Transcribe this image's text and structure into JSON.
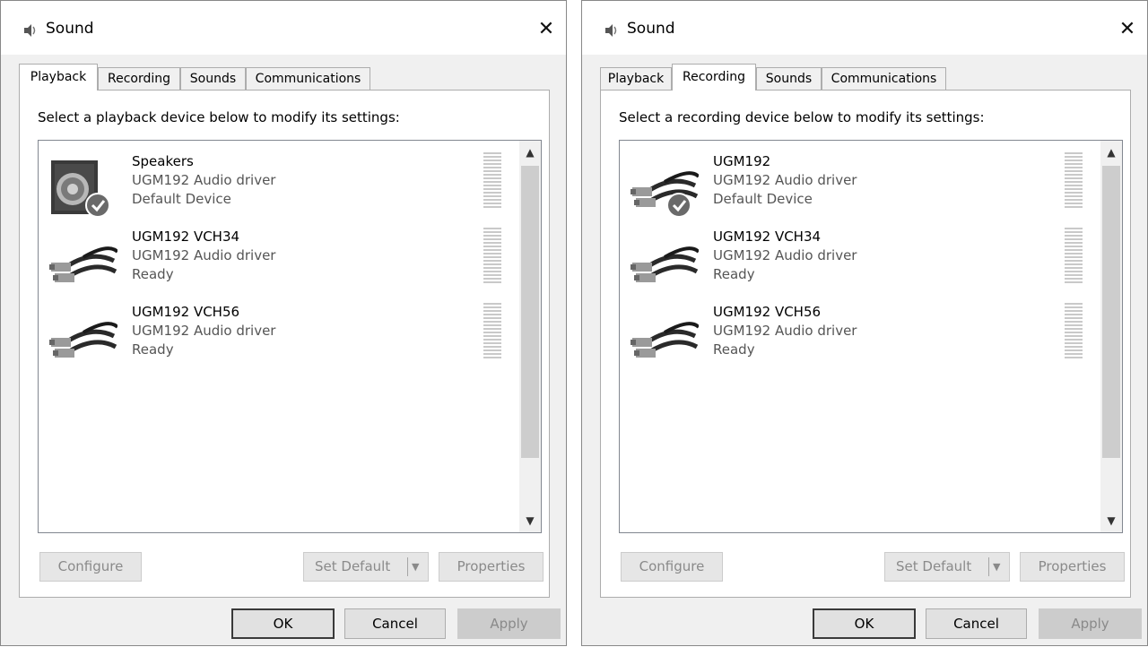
{
  "windows": [
    {
      "title": "Sound",
      "close_glyph": "✕",
      "active_tab": 0,
      "tabs": [
        "Playback",
        "Recording",
        "Sounds",
        "Communications"
      ],
      "instruction": "Select a playback device below to modify its settings:",
      "devices": [
        {
          "name": "Speakers",
          "driver": "UGM192 Audio driver",
          "status": "Default Device",
          "icon": "speaker-icon",
          "default": true
        },
        {
          "name": "UGM192 VCH34",
          "driver": "UGM192 Audio driver",
          "status": "Ready",
          "icon": "rca-cable-icon",
          "default": false
        },
        {
          "name": "UGM192 VCH56",
          "driver": "UGM192 Audio driver",
          "status": "Ready",
          "icon": "rca-cable-icon",
          "default": false
        }
      ],
      "buttons": {
        "configure": "Configure",
        "set_default": "Set Default",
        "properties": "Properties",
        "ok": "OK",
        "cancel": "Cancel",
        "apply": "Apply"
      }
    },
    {
      "title": "Sound",
      "close_glyph": "✕",
      "active_tab": 1,
      "tabs": [
        "Playback",
        "Recording",
        "Sounds",
        "Communications"
      ],
      "instruction": "Select a recording device below to modify its settings:",
      "devices": [
        {
          "name": "UGM192",
          "driver": "UGM192 Audio driver",
          "status": "Default Device",
          "icon": "rca-cable-icon",
          "default": true
        },
        {
          "name": "UGM192 VCH34",
          "driver": "UGM192 Audio driver",
          "status": "Ready",
          "icon": "rca-cable-icon",
          "default": false
        },
        {
          "name": "UGM192 VCH56",
          "driver": "UGM192 Audio driver",
          "status": "Ready",
          "icon": "rca-cable-icon",
          "default": false
        }
      ],
      "buttons": {
        "configure": "Configure",
        "set_default": "Set Default",
        "properties": "Properties",
        "ok": "OK",
        "cancel": "Cancel",
        "apply": "Apply"
      }
    }
  ]
}
